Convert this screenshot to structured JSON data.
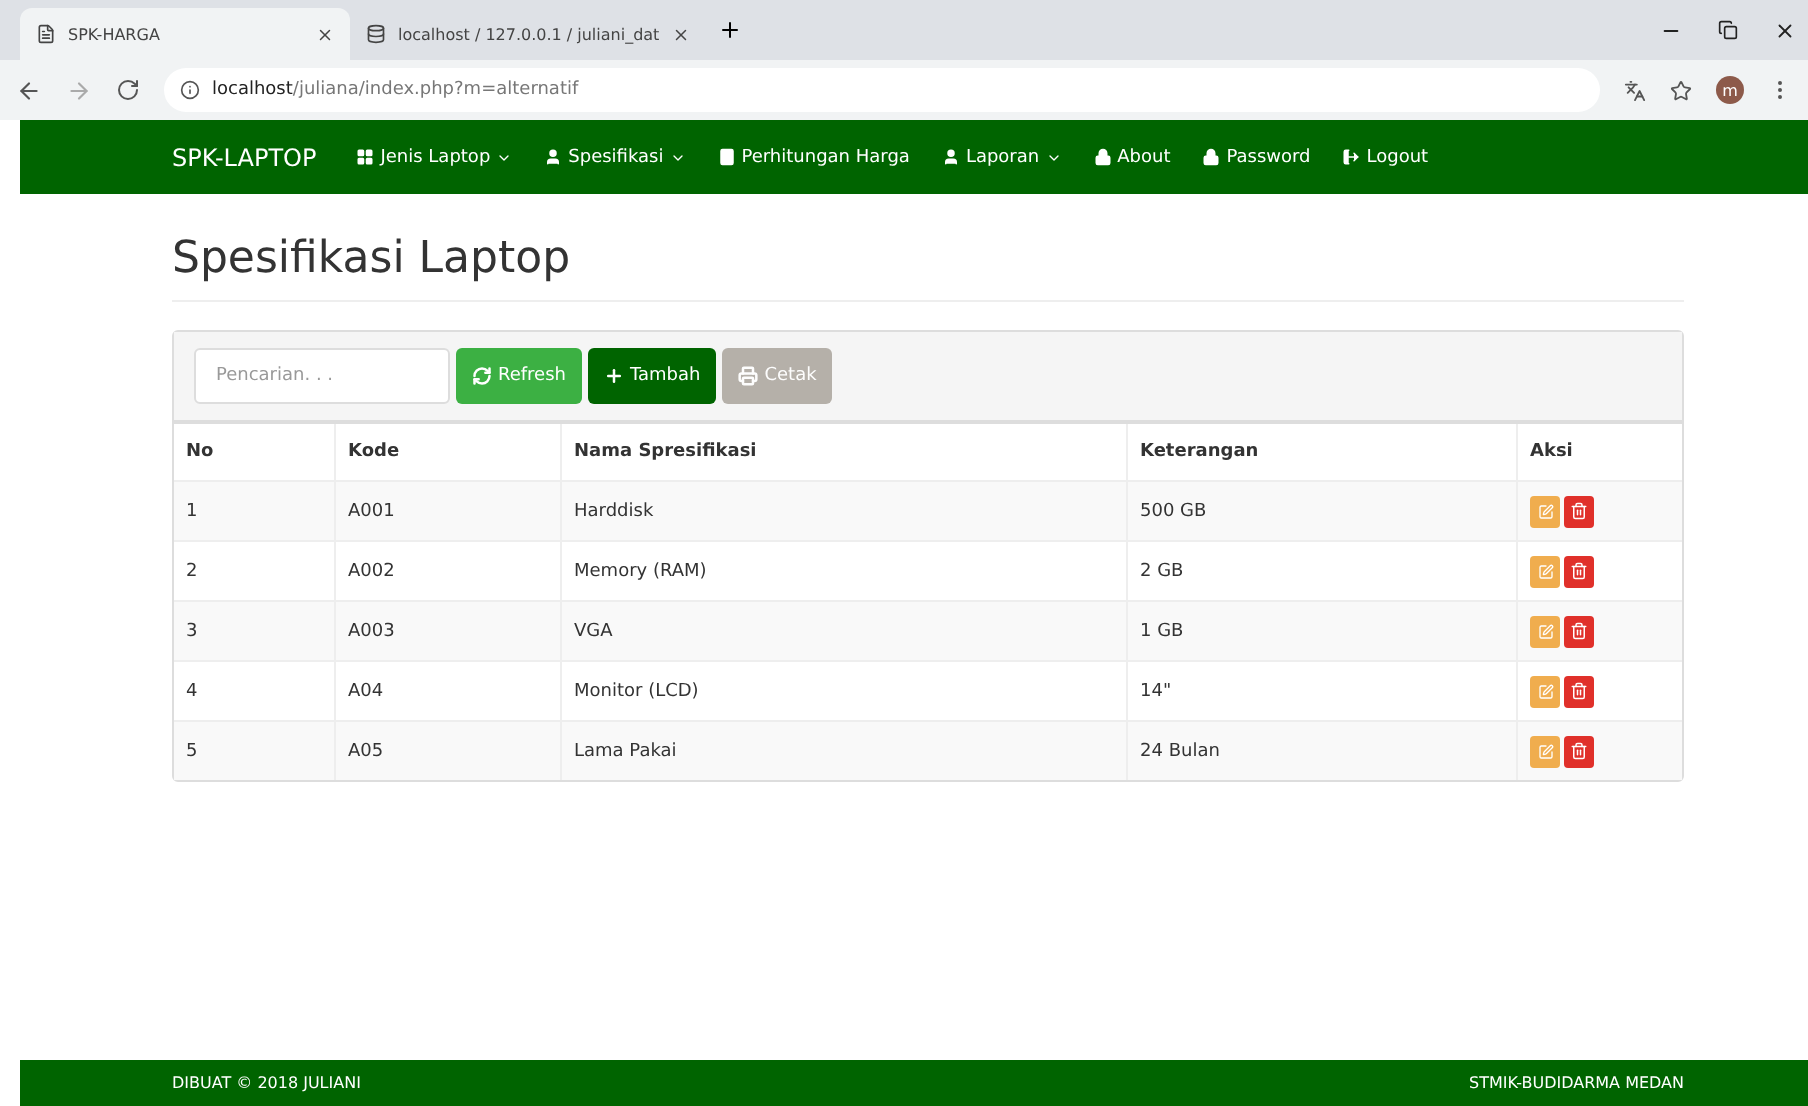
{
  "browser": {
    "tabs": [
      {
        "title": "SPK-HARGA",
        "selected": true
      },
      {
        "title": "localhost / 127.0.0.1 / juliani_dat",
        "selected": false
      }
    ],
    "url_host": "localhost",
    "url_path": "/juliana/index.php?m=alternatif",
    "profile_initial": "m"
  },
  "navbar": {
    "brand": "SPK-LAPTOP",
    "items": [
      {
        "label": "Jenis Laptop",
        "dropdown": true
      },
      {
        "label": "Spesifikasi",
        "dropdown": true
      },
      {
        "label": "Perhitungan Harga",
        "dropdown": false
      },
      {
        "label": "Laporan",
        "dropdown": true
      },
      {
        "label": "About",
        "dropdown": false
      },
      {
        "label": "Password",
        "dropdown": false
      },
      {
        "label": "Logout",
        "dropdown": false
      }
    ]
  },
  "page_title": "Spesifikasi Laptop",
  "toolbar": {
    "search": {
      "placeholder": "Pencarian. . ."
    },
    "buttons": [
      {
        "label": "Refresh",
        "kind": "refresh",
        "disabled": false
      },
      {
        "label": "Tambah",
        "kind": "add",
        "disabled": false
      },
      {
        "label": "Cetak",
        "kind": "print",
        "disabled": true
      }
    ]
  },
  "table": {
    "columns": [
      "No",
      "Kode",
      "Nama Spresifikasi",
      "Keterangan",
      "Aksi"
    ],
    "rows": [
      {
        "no": "1",
        "kode": "A001",
        "nama": "Harddisk",
        "keterangan": "500 GB"
      },
      {
        "no": "2",
        "kode": "A002",
        "nama": "Memory (RAM)",
        "keterangan": "2 GB"
      },
      {
        "no": "3",
        "kode": "A003",
        "nama": "VGA",
        "keterangan": "1 GB"
      },
      {
        "no": "4",
        "kode": "A04",
        "nama": "Monitor (LCD)",
        "keterangan": "14\""
      },
      {
        "no": "5",
        "kode": "A05",
        "nama": "Lama Pakai",
        "keterangan": "24 Bulan"
      }
    ]
  },
  "footer": {
    "left": "DIBUAT © 2018 JULIANI",
    "right": "STMIK-BUDIDARMA MEDAN"
  }
}
